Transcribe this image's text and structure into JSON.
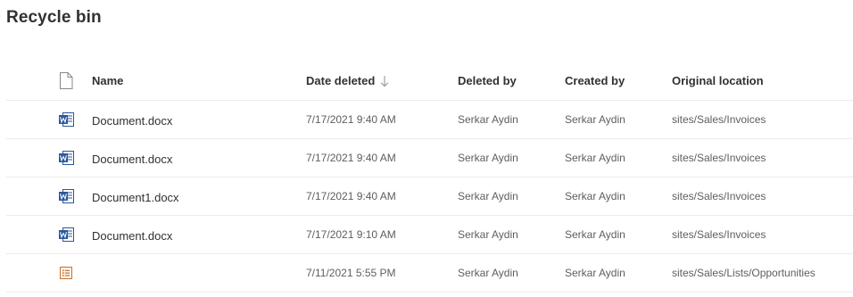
{
  "page": {
    "title": "Recycle bin"
  },
  "columns": {
    "name": "Name",
    "date_deleted": "Date deleted",
    "deleted_by": "Deleted by",
    "created_by": "Created by",
    "original_location": "Original location",
    "sort_indicator": "descending"
  },
  "rows": [
    {
      "icon": "word-document-icon",
      "name": "Document.docx",
      "date_deleted": "7/17/2021 9:40 AM",
      "deleted_by": "Serkar Aydin",
      "created_by": "Serkar Aydin",
      "original_location": "sites/Sales/Invoices"
    },
    {
      "icon": "word-document-icon",
      "name": "Document.docx",
      "date_deleted": "7/17/2021 9:40 AM",
      "deleted_by": "Serkar Aydin",
      "created_by": "Serkar Aydin",
      "original_location": "sites/Sales/Invoices"
    },
    {
      "icon": "word-document-icon",
      "name": "Document1.docx",
      "date_deleted": "7/17/2021 9:40 AM",
      "deleted_by": "Serkar Aydin",
      "created_by": "Serkar Aydin",
      "original_location": "sites/Sales/Invoices"
    },
    {
      "icon": "word-document-icon",
      "name": "Document.docx",
      "date_deleted": "7/17/2021 9:10 AM",
      "deleted_by": "Serkar Aydin",
      "created_by": "Serkar Aydin",
      "original_location": "sites/Sales/Invoices"
    },
    {
      "icon": "list-item-icon",
      "name": "",
      "date_deleted": "7/11/2021 5:55 PM",
      "deleted_by": "Serkar Aydin",
      "created_by": "Serkar Aydin",
      "original_location": "sites/Sales/Lists/Opportunities"
    }
  ],
  "colors": {
    "word_blue": "#2b579a",
    "list_orange": "#c8702a",
    "sort_arrow": "#a19f9d",
    "divider": "#edebe9"
  }
}
